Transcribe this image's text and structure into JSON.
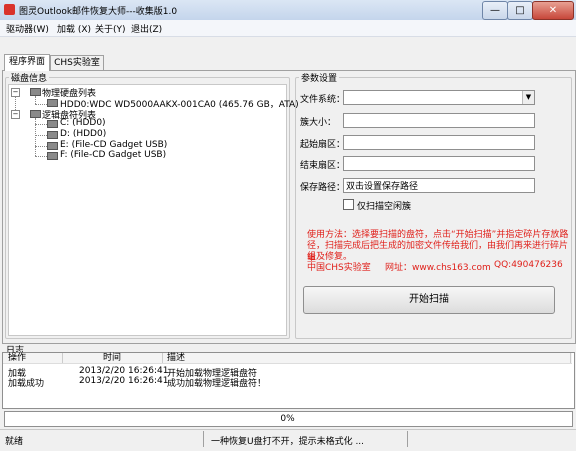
{
  "window": {
    "title": "图灵Outlook邮件恢复大师---收集版1.0",
    "min_glyph": "—",
    "max_glyph": "□",
    "close_glyph": "✕"
  },
  "menu": [
    "驱动器(W)",
    "加载 (X)",
    "关于(Y)",
    "退出(Z)"
  ],
  "tabs": [
    "程序界面",
    "CHS实验室"
  ],
  "disk_panel": {
    "title": "磁盘信息",
    "physical_label": "物理硬盘列表",
    "physical_disks": [
      "HDD0:WDC WD5000AAKX-001CA0 (465.76 GB，ATA)"
    ],
    "logical_label": "逻辑盘符列表",
    "logical_drives": [
      "C: (HDD0)",
      "D: (HDD0)",
      "E: (File-CD Gadget   USB)",
      "F: (File-CD Gadget   USB)"
    ]
  },
  "params": {
    "title": "参数设置",
    "fs_label": "文件系统：",
    "fs_value": "",
    "cluster_label": "簇大小：",
    "cluster_value": "",
    "start_label": "起始扇区：",
    "start_value": "",
    "end_label": "结束扇区：",
    "end_value": "",
    "path_label": "保存路径：",
    "path_value": "双击设置保存路径",
    "free_only_label": "仅扫描空闲簇",
    "free_only_checked": false,
    "usage_lines": [
      "使用方法：选择要扫描的盘符，点击“开始扫描”并指定碎片存放路",
      "径，扫描完成后把生成的加密文件传给我们，由我们再来进行碎片重",
      "组及修复。"
    ],
    "lab_name": "中国CHS实验室",
    "website": "网址：www.chs163.com",
    "qq": "QQ:490476236",
    "start_button": "开始扫描"
  },
  "log": {
    "title": "日志",
    "columns": [
      "操作",
      "时间",
      "描述"
    ],
    "rows": [
      {
        "op": "加载",
        "time": "2013/2/20 16:26:41",
        "desc": "开始加载物理逻辑盘符"
      },
      {
        "op": "加载成功",
        "time": "2013/2/20 16:26:41",
        "desc": "成功加载物理逻辑盘符！"
      }
    ]
  },
  "progress": {
    "value": 0,
    "label": "0%"
  },
  "status": {
    "left": "就绪",
    "message": "一种恢复U盘打不开，提示未格式化 ..."
  },
  "colors": {
    "accent_red": "#e0211b",
    "progress_green": "#3cb043",
    "titlebar": "#c4d5ec"
  }
}
